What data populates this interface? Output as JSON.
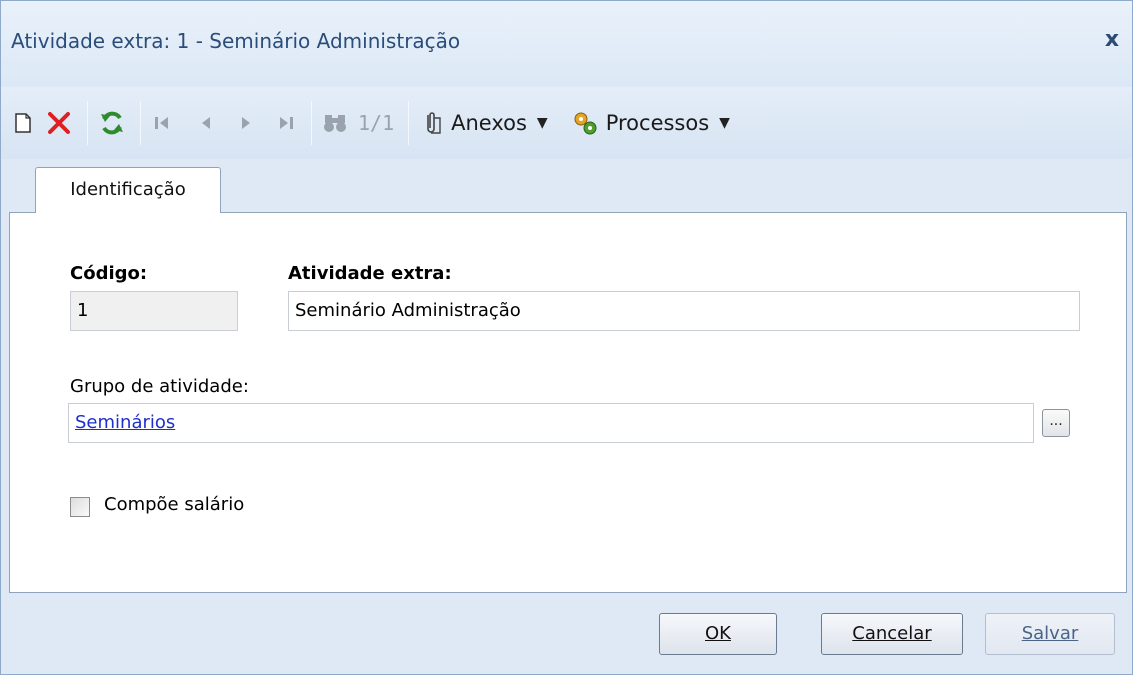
{
  "window": {
    "title": "Atividade extra: 1 - Seminário Administração",
    "close_label": "x"
  },
  "toolbar": {
    "record_counter": "1/1",
    "attachments_label": "Anexos",
    "processes_label": "Processos"
  },
  "tabs": [
    {
      "label": "Identificação",
      "active": true
    }
  ],
  "form": {
    "code_label": "Código:",
    "code_value": "1",
    "activity_label": "Atividade extra:",
    "activity_value": "Seminário Administração",
    "group_label": "Grupo de atividade:",
    "group_value": "Seminários",
    "group_lookup_label": "...",
    "salary_checkbox_label": "Compõe salário",
    "salary_checked": false
  },
  "footer": {
    "ok_label": "OK",
    "cancel_label": "Cancelar",
    "save_label": "Salvar"
  },
  "colors": {
    "title_text": "#2a4d7a",
    "link": "#1e2fcc",
    "delete_icon": "#e02020",
    "refresh_icon": "#2e8b2e"
  }
}
